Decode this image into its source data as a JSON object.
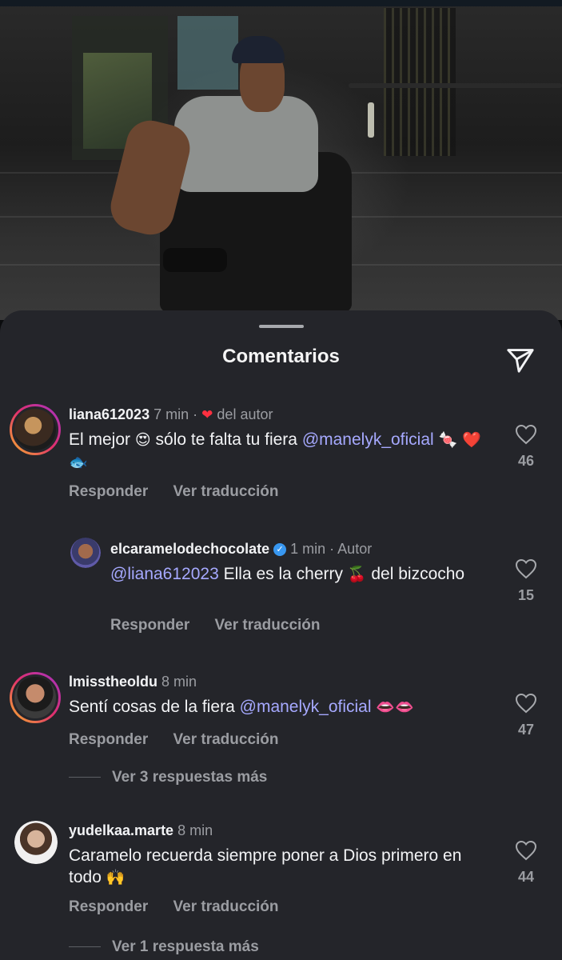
{
  "sheet": {
    "title": "Comentarios",
    "share_icon": "paper-plane-icon"
  },
  "comments": [
    {
      "username": "liana612023",
      "time": "7 min",
      "separator": "·",
      "author_like_label": "del autor",
      "text_before": "El mejor",
      "emoji_1": "😍",
      "text_middle": "sólo te falta tu fiera",
      "mention": "@manelyk_oficial",
      "emoji_tail": "🍬 ❤️ 🐟",
      "reply_label": "Responder",
      "translate_label": "Ver traducción",
      "likes": "46"
    },
    {
      "username": "elcaramelodechocolate",
      "time": "1 min",
      "separator": "·",
      "role_label": "Autor",
      "mention": "@liana612023",
      "text_before": "Ella es la cherry",
      "emoji_1": "🍒",
      "text_after": "del bizcocho",
      "reply_label": "Responder",
      "translate_label": "Ver traducción",
      "likes": "15"
    },
    {
      "username": "lmisstheoldu",
      "time": "8 min",
      "text_before": "Sentí cosas de la fiera",
      "mention": "@manelyk_oficial",
      "emoji_tail": "👄👄",
      "reply_label": "Responder",
      "translate_label": "Ver traducción",
      "likes": "47",
      "more_replies": "Ver 3 respuestas más"
    },
    {
      "username": "yudelkaa.marte",
      "time": "8 min",
      "text_before": "Caramelo recuerda siempre poner a Dios primero en todo",
      "emoji_1": "🙌",
      "reply_label": "Responder",
      "translate_label": "Ver traducción",
      "likes": "44",
      "more_replies": "Ver 1 respuesta más"
    }
  ]
}
